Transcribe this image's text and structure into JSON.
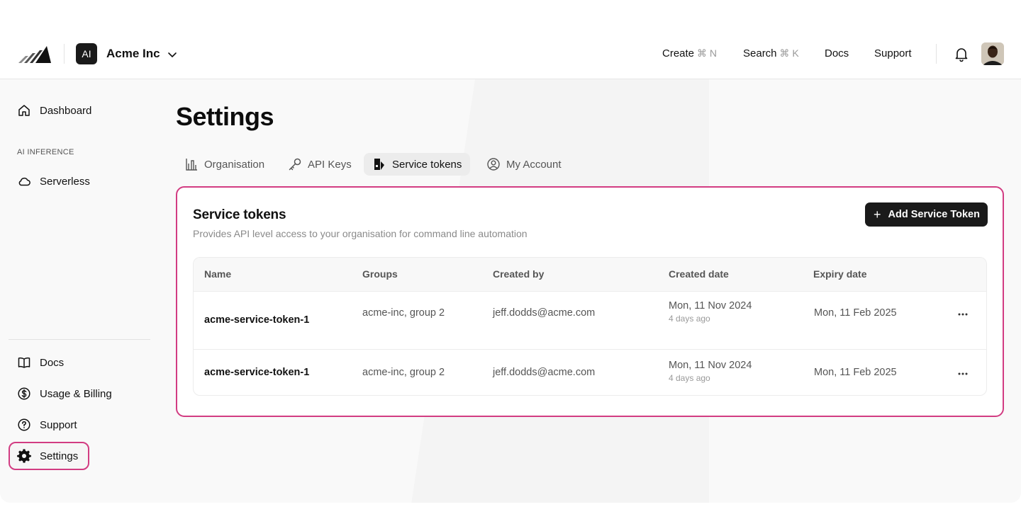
{
  "header": {
    "org_badge": "AI",
    "org_name": "Acme Inc",
    "nav": [
      {
        "label": "Create",
        "shortcut": "⌘ N"
      },
      {
        "label": "Search",
        "shortcut": "⌘ K"
      },
      {
        "label": "Docs"
      },
      {
        "label": "Support"
      }
    ]
  },
  "sidebar": {
    "top_items": [
      {
        "label": "Dashboard",
        "icon": "home-icon"
      }
    ],
    "section_label": "AI INFERENCE",
    "section_items": [
      {
        "label": "Serverless",
        "icon": "cloud-icon"
      }
    ],
    "bottom_items": [
      {
        "label": "Docs",
        "icon": "book-icon"
      },
      {
        "label": "Usage & Billing",
        "icon": "dollar-circle-icon"
      },
      {
        "label": "Support",
        "icon": "help-circle-icon"
      },
      {
        "label": "Settings",
        "icon": "gear-icon",
        "active": true
      }
    ]
  },
  "page": {
    "title": "Settings",
    "tabs": [
      {
        "label": "Organisation",
        "icon": "building-chart-icon"
      },
      {
        "label": "API Keys",
        "icon": "key-icon"
      },
      {
        "label": "Service tokens",
        "icon": "token-icon",
        "active": true
      },
      {
        "label": "My Account",
        "icon": "user-circle-icon"
      }
    ]
  },
  "card": {
    "title": "Service tokens",
    "subtitle": "Provides API level access to your organisation for command line automation",
    "add_button": "Add Service Token",
    "columns": [
      "Name",
      "Groups",
      "Created by",
      "Created date",
      "Expiry date"
    ],
    "rows": [
      {
        "name": "acme-service-token-1",
        "groups": "acme-inc, group 2",
        "created_by": "jeff.dodds@acme.com",
        "created_date": "Mon, 11 Nov 2024",
        "created_relative": "4 days ago",
        "expiry_date": "Mon, 11 Feb 2025"
      },
      {
        "name": "acme-service-token-1",
        "groups": "acme-inc, group 2",
        "created_by": "jeff.dodds@acme.com",
        "created_date": "Mon, 11 Nov 2024",
        "created_relative": "4 days ago",
        "expiry_date": "Mon, 11 Feb 2025"
      }
    ]
  },
  "colors": {
    "accent_highlight": "#d23c82",
    "primary_button": "#1a1a1a"
  }
}
